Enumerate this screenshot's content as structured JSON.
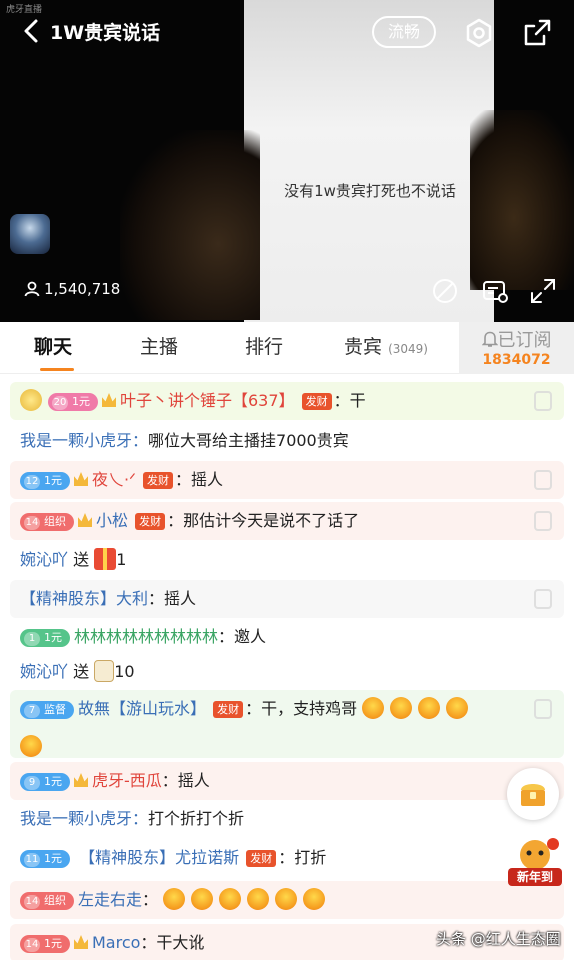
{
  "header": {
    "title": "1W贵宾说话",
    "quality": "流畅",
    "watermark": "虎牙直播"
  },
  "video": {
    "caption": "没有1w贵宾打死也不说话",
    "viewer_count": "1,540,718"
  },
  "tabs": [
    {
      "label": "聊天"
    },
    {
      "label": "主播"
    },
    {
      "label": "排行"
    },
    {
      "label": "贵宾",
      "count": "(3049)"
    }
  ],
  "subscribe": {
    "label": "已订阅",
    "count": "1834072"
  },
  "chat": [
    {
      "level": "20",
      "badge": "1元",
      "name": "叶子丶讲个锤子【637】",
      "tag": "发财",
      "text": "：干"
    },
    {
      "sys": "我是一颗小虎牙：",
      "text": "哪位大哥给主播挂7000贵宾"
    },
    {
      "level": "12",
      "badge": "1元",
      "name": "夜乀·ᐟ",
      "tag": "发财",
      "text": "：摇人"
    },
    {
      "level": "14",
      "badge": "组织",
      "name": "小松",
      "tag": "发财",
      "text": "：那估计今天是说不了话了"
    },
    {
      "name": "婉沁吖",
      "text": "送",
      "count": "1"
    },
    {
      "name": "【精神股东】大利",
      "text": "：摇人"
    },
    {
      "level": "1",
      "badge": "1元",
      "name": "林林林林林林林林林",
      "text": "：邀人"
    },
    {
      "name": "婉沁吖",
      "text": "送",
      "count": "10"
    },
    {
      "level": "7",
      "badge": "监督",
      "name": "故無【游山玩水】",
      "tag": "发财",
      "text": "：干，支持鸡哥"
    },
    {
      "level": "9",
      "badge": "1元",
      "name": "虎牙-西瓜",
      "text": "：摇人"
    },
    {
      "sys": "我是一颗小虎牙：",
      "text": "打个折打个折"
    },
    {
      "level": "11",
      "badge": "1元",
      "name": "【精神股东】尤拉诺斯",
      "tag": "发财",
      "text": "：打折"
    },
    {
      "level": "14",
      "badge": "组织",
      "name": "左走右走",
      "text": "："
    },
    {
      "level": "14",
      "badge": "1元",
      "name": "Marco",
      "text": "：干大讹"
    }
  ],
  "side": {
    "newyear_label": "新年到",
    "source_tag": "头条 @红人生态圈"
  },
  "colors": {
    "accent": "#f5841f",
    "nick_red": "#e0443b",
    "nick_blue": "#3a6fb6",
    "fa_tag": "#e8532c"
  }
}
